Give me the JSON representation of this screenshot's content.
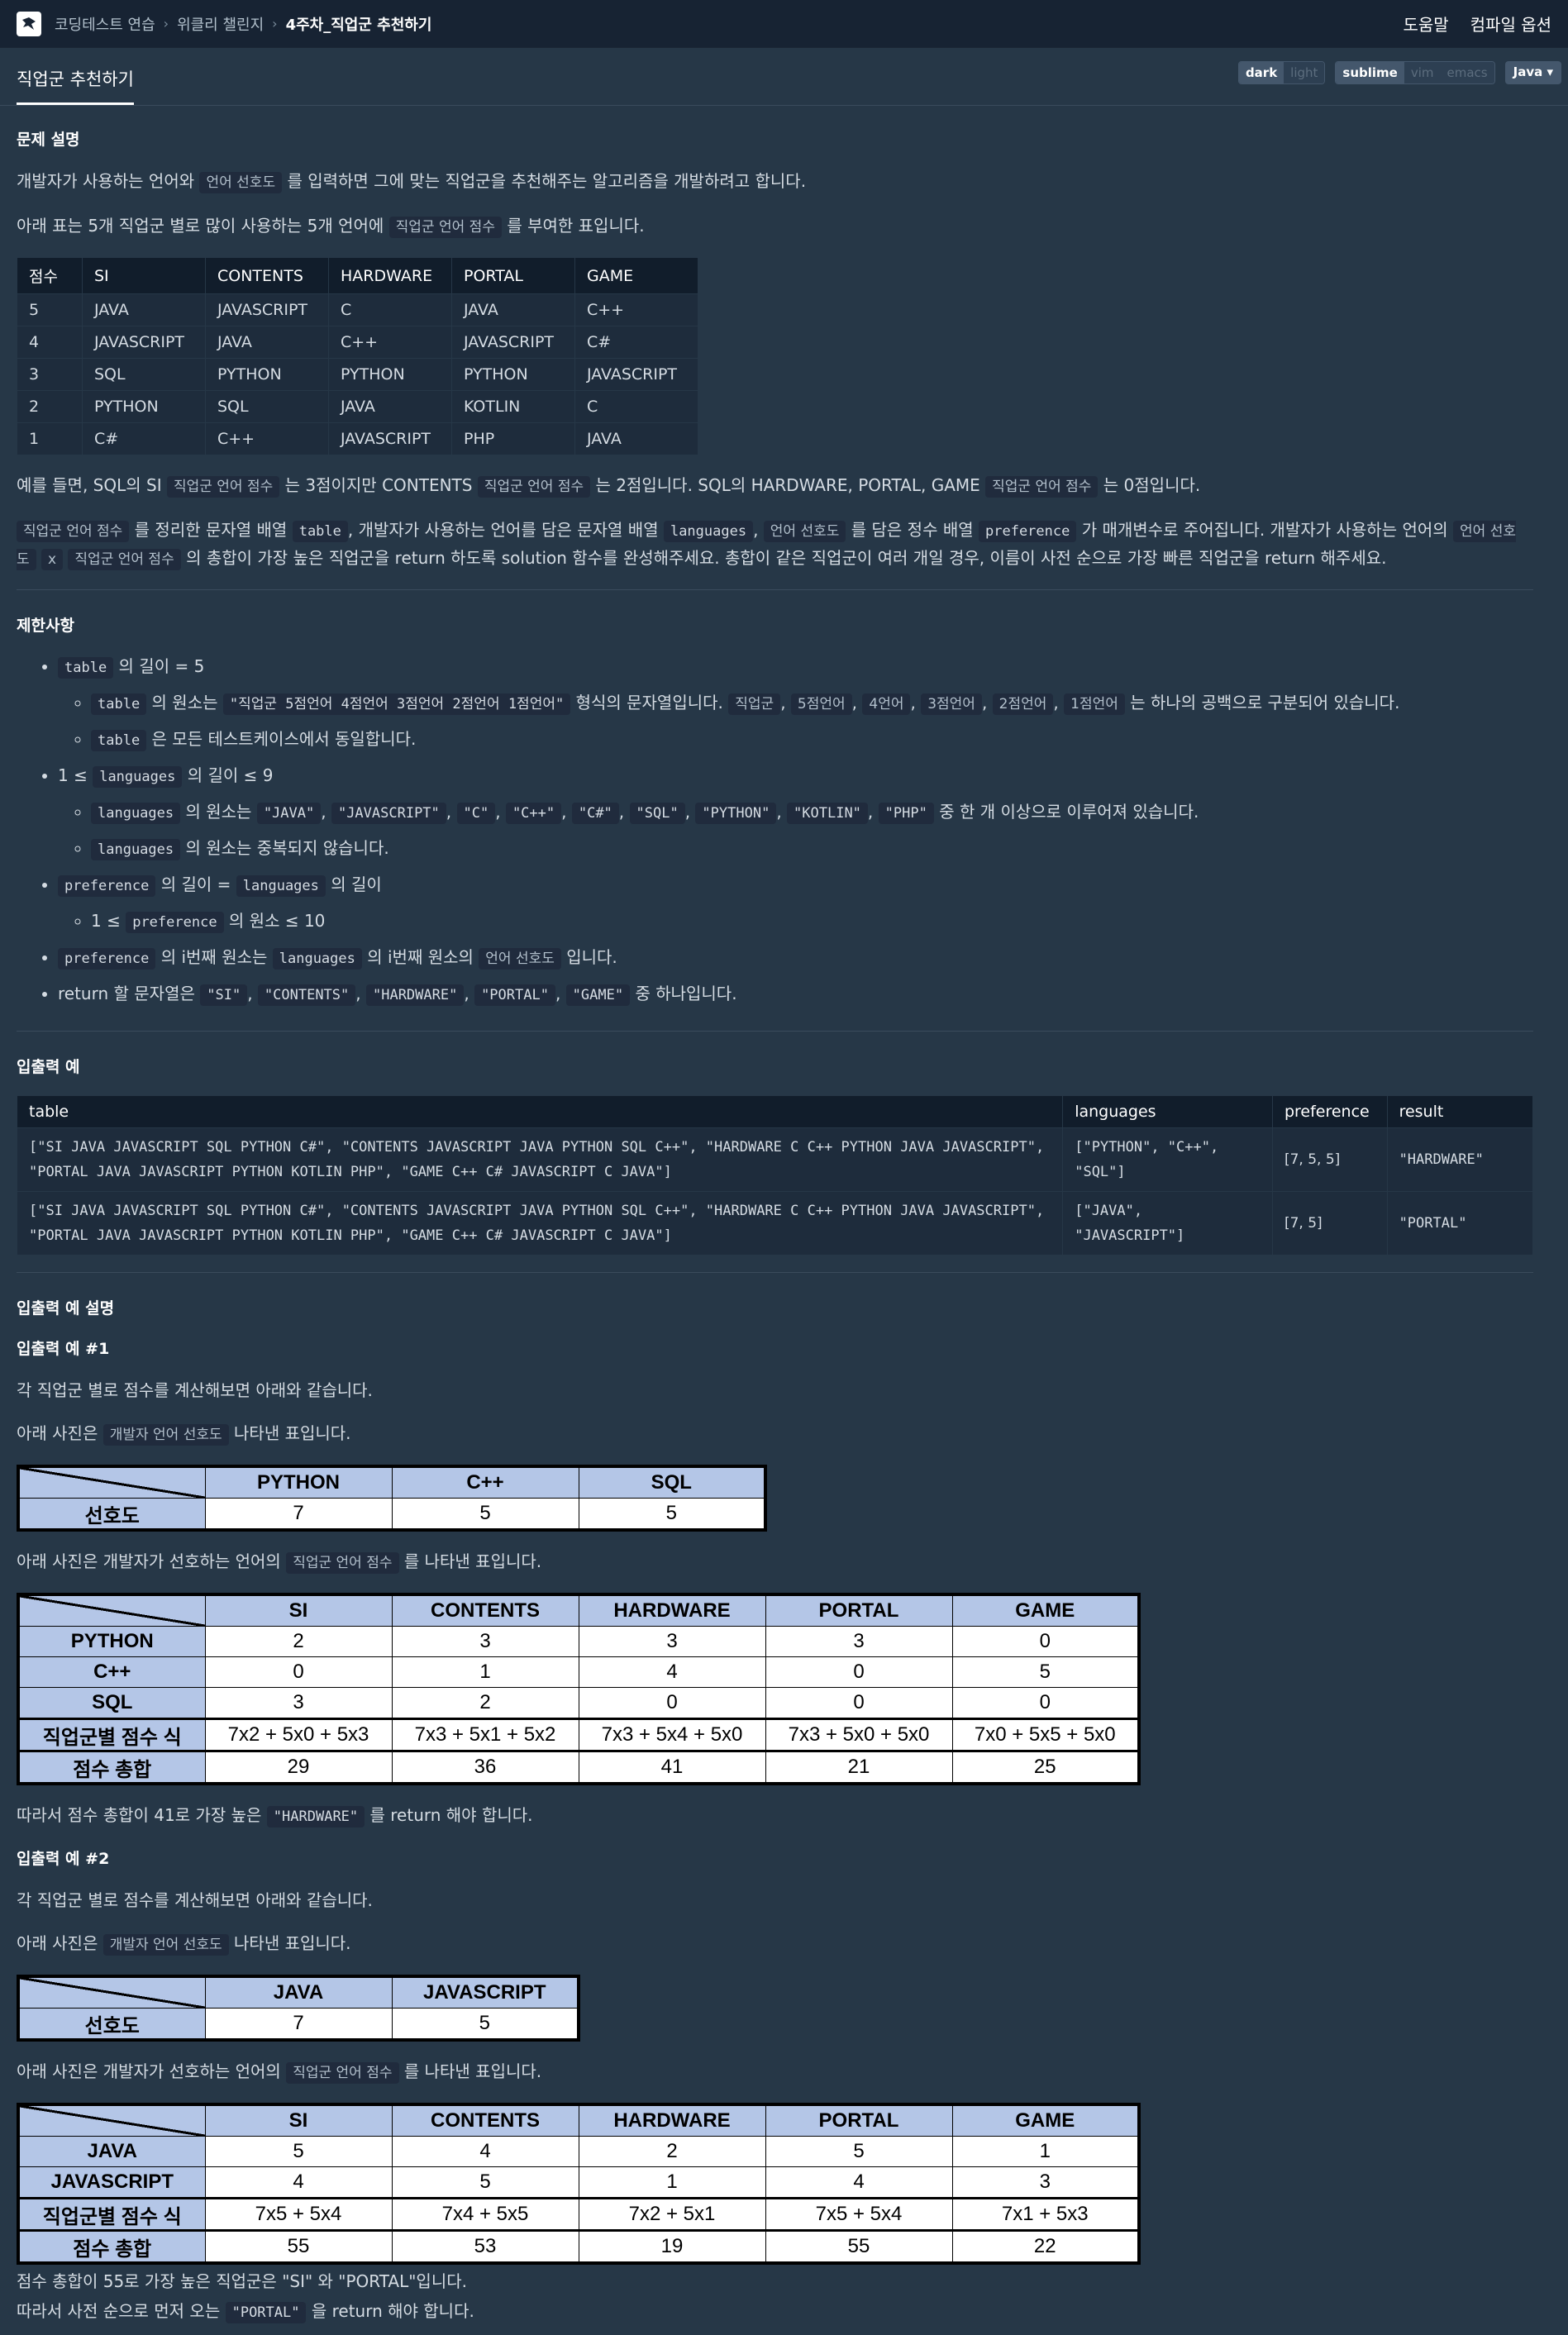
{
  "breadcrumb": [
    "코딩테스트 연습",
    "위클리 챌린지",
    "4주차_직업군 추천하기"
  ],
  "header_links": {
    "help": "도움말",
    "compile": "컴파일 옵션"
  },
  "tab_title": "직업군 추천하기",
  "theme_options": [
    "dark",
    "light"
  ],
  "editor_options": [
    "sublime",
    "vim",
    "emacs"
  ],
  "language": "Java",
  "section_desc": "문제 설명",
  "section_limits": "제한사항",
  "section_io": "입출력 예",
  "section_io_desc": "입출력 예 설명",
  "score_table": {
    "headers": [
      "점수",
      "SI",
      "CONTENTS",
      "HARDWARE",
      "PORTAL",
      "GAME"
    ],
    "rows": [
      [
        "5",
        "JAVA",
        "JAVASCRIPT",
        "C",
        "JAVA",
        "C++"
      ],
      [
        "4",
        "JAVASCRIPT",
        "JAVA",
        "C++",
        "JAVASCRIPT",
        "C#"
      ],
      [
        "3",
        "SQL",
        "PYTHON",
        "PYTHON",
        "PYTHON",
        "JAVASCRIPT"
      ],
      [
        "2",
        "PYTHON",
        "SQL",
        "JAVA",
        "KOTLIN",
        "C"
      ],
      [
        "1",
        "C#",
        "C++",
        "JAVASCRIPT",
        "PHP",
        "JAVA"
      ]
    ]
  },
  "io_table": {
    "headers": [
      "table",
      "languages",
      "preference",
      "result"
    ],
    "rows": [
      [
        "[\"SI JAVA JAVASCRIPT SQL PYTHON C#\", \"CONTENTS JAVASCRIPT JAVA PYTHON SQL C++\", \"HARDWARE C C++ PYTHON JAVA JAVASCRIPT\", \"PORTAL JAVA JAVASCRIPT PYTHON KOTLIN PHP\", \"GAME C++ C# JAVASCRIPT C JAVA\"]",
        "[\"PYTHON\", \"C++\", \"SQL\"]",
        "[7, 5, 5]",
        "\"HARDWARE\""
      ],
      [
        "[\"SI JAVA JAVASCRIPT SQL PYTHON C#\", \"CONTENTS JAVASCRIPT JAVA PYTHON SQL C++\", \"HARDWARE C C++ PYTHON JAVA JAVASCRIPT\", \"PORTAL JAVA JAVASCRIPT PYTHON KOTLIN PHP\", \"GAME C++ C# JAVASCRIPT C JAVA\"]",
        "[\"JAVA\", \"JAVASCRIPT\"]",
        "[7, 5]",
        "\"PORTAL\""
      ]
    ]
  },
  "ex1": {
    "title": "입출력 예 #1",
    "pref_headers": [
      "PYTHON",
      "C++",
      "SQL"
    ],
    "pref_label": "선호도",
    "pref_values": [
      "7",
      "5",
      "5"
    ],
    "score_headers": [
      "SI",
      "CONTENTS",
      "HARDWARE",
      "PORTAL",
      "GAME"
    ],
    "score_rows": [
      [
        "PYTHON",
        "2",
        "3",
        "3",
        "3",
        "0"
      ],
      [
        "C++",
        "0",
        "1",
        "4",
        "0",
        "5"
      ],
      [
        "SQL",
        "3",
        "2",
        "0",
        "0",
        "0"
      ],
      [
        "직업군별 점수 식",
        "7x2 + 5x0 + 5x3",
        "7x3 + 5x1 + 5x2",
        "7x3 + 5x4 + 5x0",
        "7x3 + 5x0 + 5x0",
        "7x0 + 5x5 + 5x0"
      ],
      [
        "점수 총합",
        "29",
        "36",
        "41",
        "21",
        "25"
      ]
    ]
  },
  "ex2": {
    "title": "입출력 예 #2",
    "pref_headers": [
      "JAVA",
      "JAVASCRIPT"
    ],
    "pref_label": "선호도",
    "pref_values": [
      "7",
      "5"
    ],
    "score_headers": [
      "SI",
      "CONTENTS",
      "HARDWARE",
      "PORTAL",
      "GAME"
    ],
    "score_rows": [
      [
        "JAVA",
        "5",
        "4",
        "2",
        "5",
        "1"
      ],
      [
        "JAVASCRIPT",
        "4",
        "5",
        "1",
        "4",
        "3"
      ],
      [
        "직업군별 점수 식",
        "7x5 + 5x4",
        "7x4 + 5x5",
        "7x2 + 5x1",
        "7x5 + 5x4",
        "7x1 + 5x3"
      ],
      [
        "점수 총합",
        "55",
        "53",
        "19",
        "55",
        "22"
      ]
    ]
  },
  "text": {
    "p1a": "개발자가 사용하는 언어와",
    "p1c": "언어 선호도",
    "p1b": "를 입력하면 그에 맞는 직업군을 추천해주는 알고리즘을 개발하려고 합니다.",
    "p2a": "아래 표는 5개 직업군 별로 많이 사용하는 5개 언어에",
    "p2c": "직업군 언어 점수",
    "p2b": "를 부여한 표입니다.",
    "p3a": "예를 들면, SQL의 SI",
    "p3c1": "직업군 언어 점수",
    "p3b": "는 3점이지만 CONTENTS",
    "p3c2": "직업군 언어 점수",
    "p3d": "는 2점입니다. SQL의 HARDWARE, PORTAL, GAME",
    "p3c3": "직업군 언어 점수",
    "p3e": "는 0점입니다.",
    "p4c1": "직업군 언어 점수",
    "p4a": "를 정리한 문자열 배열",
    "p4c2": "table",
    "p4b": ", 개발자가 사용하는 언어를 담은 문자열 배열",
    "p4c3": "languages",
    "p4d": ",",
    "p4c4": "언어 선호도",
    "p4e": "를 담은 정수 배열",
    "p4c5": "preference",
    "p4f": "가 매개변수로 주어집니다. 개발자가 사용하는 언어의",
    "p4c6": "언어 선호도",
    "p4g": "x",
    "p4c7": "직업군 언어 점수",
    "p4h": "의 총합이 가장 높은 직업군을 return 하도록 solution 함수를 완성해주세요. 총합이 같은 직업군이 여러 개일 경우, 이름이 사전 순으로 가장 빠른 직업군을 return 해주세요.",
    "l1c": "table",
    "l1a": "의 길이 = 5",
    "l1s1c1": "table",
    "l1s1a": "의 원소는",
    "l1s1c2": "\"직업군 5점언어 4점언어 3점언어 2점언어 1점언어\"",
    "l1s1b": "형식의 문자열입니다.",
    "l1s1k1": "직업군",
    "l1s1k2": "5점언어",
    "l1s1k3": "4언어",
    "l1s1k4": "3점언어",
    "l1s1k5": "2점언어",
    "l1s1k6": "1점언어",
    "l1s1c": "는 하나의 공백으로 구분되어 있습니다.",
    "l1s2c": "table",
    "l1s2a": "은 모든 테스트케이스에서 동일합니다.",
    "l2a": "1 ≤",
    "l2c": "languages",
    "l2b": "의 길이 ≤ 9",
    "l2s1c": "languages",
    "l2s1a": "의 원소는",
    "l2s1v": [
      "\"JAVA\"",
      "\"JAVASCRIPT\"",
      "\"C\"",
      "\"C++\"",
      "\"C#\"",
      "\"SQL\"",
      "\"PYTHON\"",
      "\"KOTLIN\"",
      "\"PHP\""
    ],
    "l2s1b": "중 한 개 이상으로 이루어져 있습니다.",
    "l2s2c": "languages",
    "l2s2a": "의 원소는 중복되지 않습니다.",
    "l3c1": "preference",
    "l3a": "의 길이 =",
    "l3c2": "languages",
    "l3b": "의 길이",
    "l3s1a": "1 ≤",
    "l3s1c": "preference",
    "l3s1b": "의 원소 ≤ 10",
    "l4c1": "preference",
    "l4a": "의 i번째 원소는",
    "l4c2": "languages",
    "l4b": "의 i번째 원소의",
    "l4c3": "언어 선호도",
    "l4d": "입니다.",
    "l5a": "return 할 문자열은",
    "l5v": [
      "\"SI\"",
      "\"CONTENTS\"",
      "\"HARDWARE\"",
      "\"PORTAL\"",
      "\"GAME\""
    ],
    "l5b": "중 하나입니다.",
    "e1p1": "각 직업군 별로 점수를 계산해보면 아래와 같습니다.",
    "e1p2a": "아래 사진은",
    "e1p2c": "개발자 언어 선호도",
    "e1p2b": "나타낸 표입니다.",
    "e1p3a": "아래 사진은 개발자가 선호하는 언어의",
    "e1p3c": "직업군 언어 점수",
    "e1p3b": "를 나타낸 표입니다.",
    "e1p4a": "따라서 점수 총합이 41로 가장 높은",
    "e1p4c": "\"HARDWARE\"",
    "e1p4b": "를 return 해야 합니다.",
    "e2p1": "각 직업군 별로 점수를 계산해보면 아래와 같습니다.",
    "e2p2a": "아래 사진은",
    "e2p2c": "개발자 언어 선호도",
    "e2p2b": "나타낸 표입니다.",
    "e2p3a": "아래 사진은 개발자가 선호하는 언어의",
    "e2p3c": "직업군 언어 점수",
    "e2p3b": "를 나타낸 표입니다.",
    "e2p4": "점수 총합이 55로 가장 높은 직업군은 \"SI\" 와 \"PORTAL\"입니다.",
    "e2p5a": "따라서 사전 순으로 먼저 오는",
    "e2p5c": "\"PORTAL\"",
    "e2p5b": "을 return 해야 합니다."
  }
}
